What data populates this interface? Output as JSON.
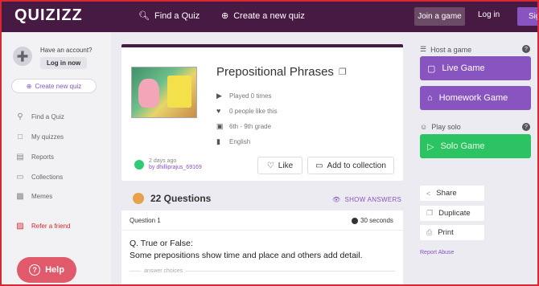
{
  "header": {
    "logo": "QUIZIZZ",
    "find_quiz": "Find a Quiz",
    "create_quiz": "Create a new quiz",
    "join_game": "Join a game",
    "login": "Log in",
    "signup": "Sig"
  },
  "sidebar": {
    "account_prompt": "Have an account?",
    "login_now": "Log in now",
    "create_new_quiz": "Create new quiz",
    "items": [
      {
        "label": "Find a Quiz",
        "icon": "search-icon"
      },
      {
        "label": "My quizzes",
        "icon": "document-icon"
      },
      {
        "label": "Reports",
        "icon": "chart-icon"
      },
      {
        "label": "Collections",
        "icon": "folder-icon"
      },
      {
        "label": "Memes",
        "icon": "image-icon"
      }
    ],
    "refer": "Refer a friend",
    "help": "Help"
  },
  "quiz": {
    "title": "Prepositional Phrases",
    "played": "Played 0 times",
    "likes": "0 people like this",
    "grade": "6th - 9th grade",
    "subject": "English",
    "author_time": "2 days ago",
    "author_by": "by dhilliprajus_69169",
    "like_label": "Like",
    "collection_label": "Add to collection"
  },
  "questions": {
    "count": "22 Questions",
    "show_answers": "SHOW ANSWERS",
    "first": {
      "number": "Question 1",
      "time": "30 seconds",
      "text_line1": "Q. True or False:",
      "text_line2": "Some prepositions show time and place and others add detail.",
      "choices_label": "answer choices"
    }
  },
  "right": {
    "host_label": "Host a game",
    "live_game": "Live Game",
    "homework_game": "Homework Game",
    "solo_label": "Play solo",
    "solo_game": "Solo Game",
    "share": "Share",
    "duplicate": "Duplicate",
    "print": "Print",
    "report_abuse": "Report Abuse",
    "help_mark": "?"
  },
  "colors": {
    "header_bg": "#461a42",
    "accent_purple": "#8854c0",
    "solo_green": "#2cc462",
    "help_red": "#e05a6b"
  }
}
